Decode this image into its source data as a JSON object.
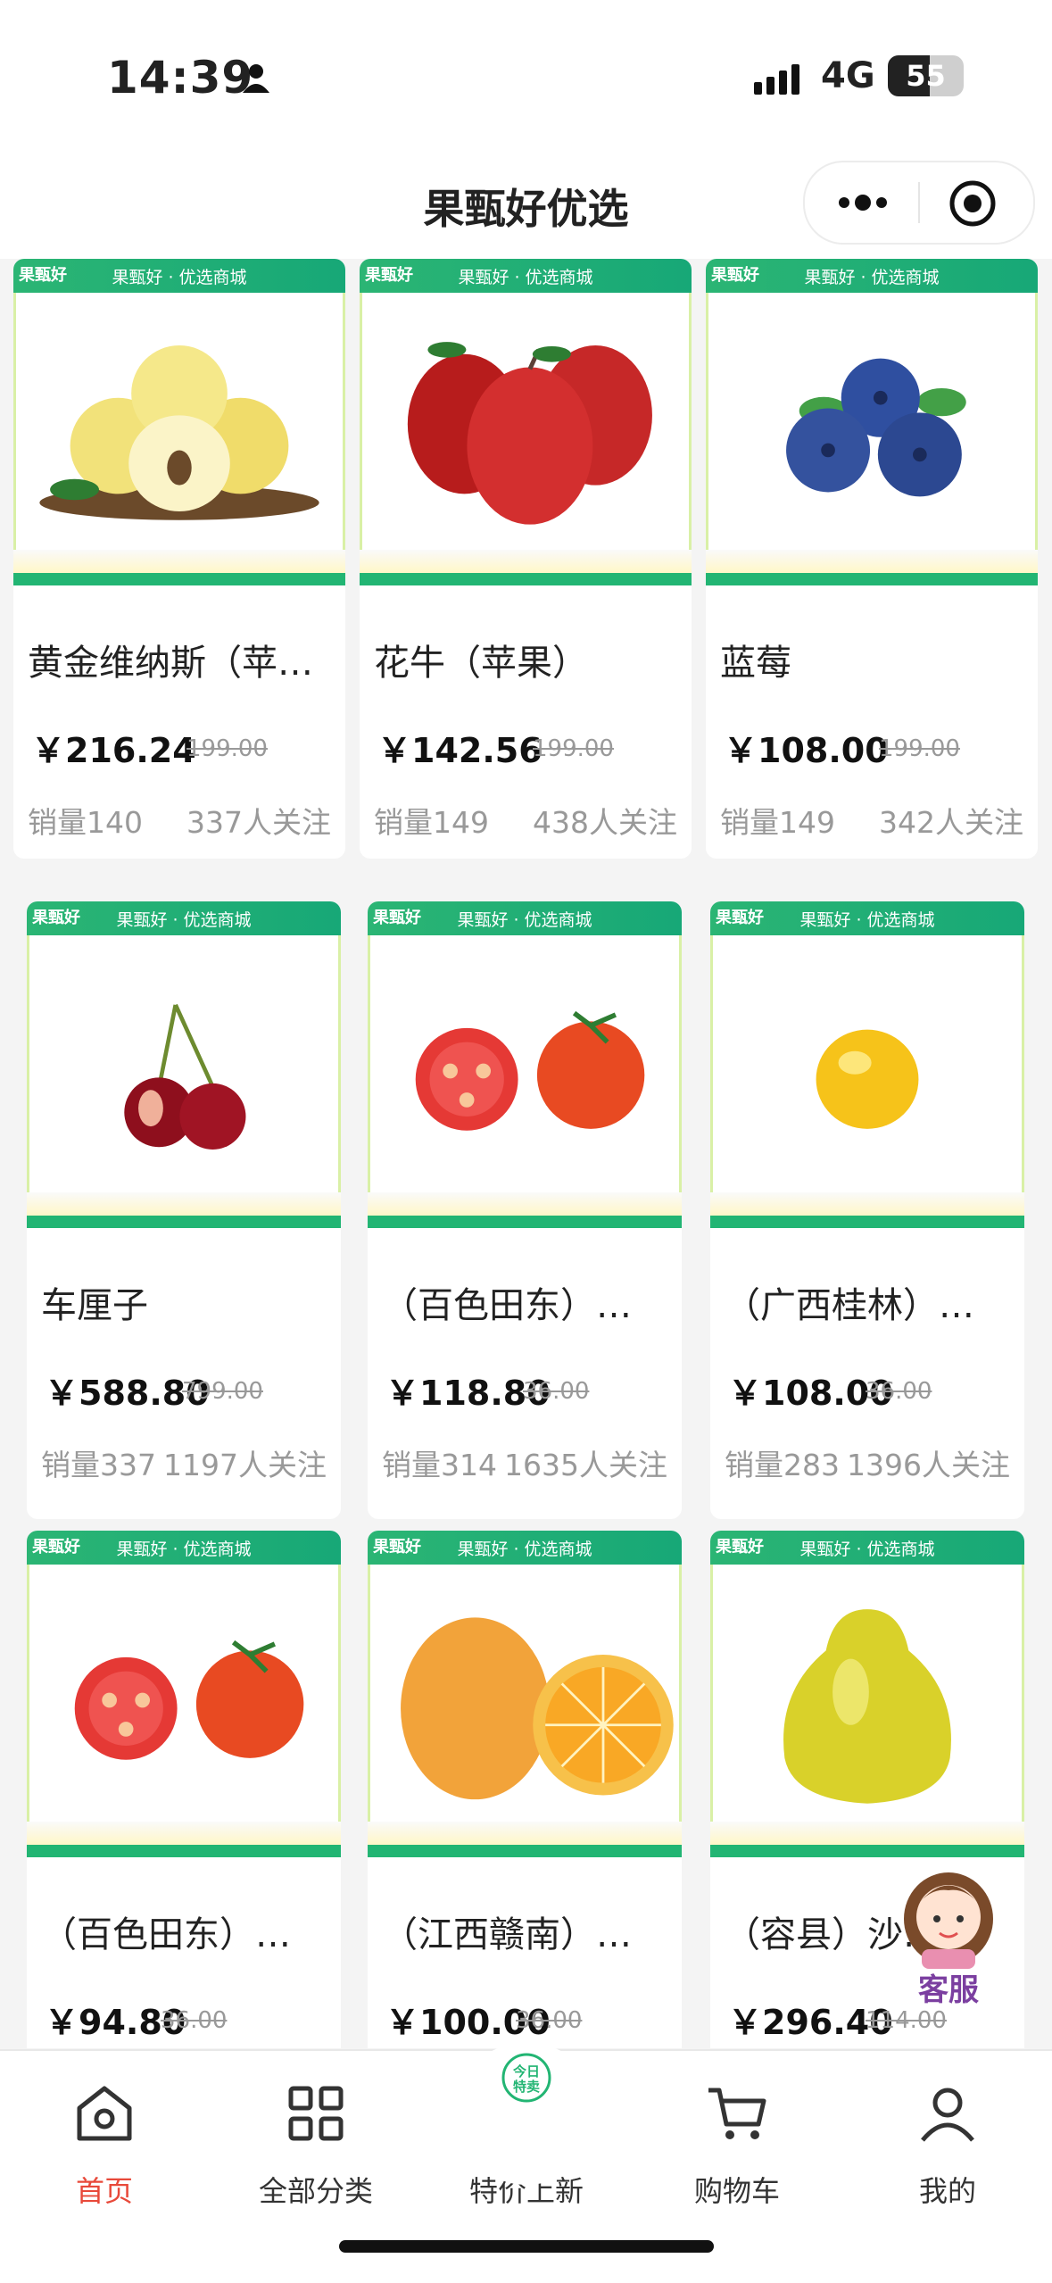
{
  "status_bar": {
    "time": "14:39",
    "network": "4G",
    "battery": "55",
    "battery_level": 0.55
  },
  "nav": {
    "title": "果甄好优选"
  },
  "banner": {
    "shop_text": "果甄好 · 优选商城",
    "logo_text": "果甄好"
  },
  "products": [
    {
      "name": "黄金维纳斯（苹果）",
      "price": "￥216.24",
      "old_price": "199.00",
      "sales": "销量140",
      "follow": "337人关注",
      "icon": "yellow-apple-icon"
    },
    {
      "name": "花牛（苹果）",
      "price": "￥142.56",
      "old_price": "199.00",
      "sales": "销量149",
      "follow": "438人关注",
      "icon": "red-apple-icon"
    },
    {
      "name": "蓝莓",
      "price": "￥108.00",
      "old_price": "199.00",
      "sales": "销量149",
      "follow": "342人关注",
      "icon": "blueberry-icon"
    },
    {
      "name": "车厘子",
      "price": "￥588.80",
      "old_price": "799.00",
      "sales": "销量337",
      "follow": "1197人关注",
      "icon": "cherry-icon"
    },
    {
      "name": "（百色田东）…",
      "price": "￥118.80",
      "old_price": "36.00",
      "sales": "销量314",
      "follow": "1635人关注",
      "icon": "tomato-icon"
    },
    {
      "name": "（广西桂林）…",
      "price": "￥108.00",
      "old_price": "36.00",
      "sales": "销量283",
      "follow": "1396人关注",
      "icon": "lemon-icon"
    },
    {
      "name": "（百色田东）…",
      "price": "￥94.80",
      "old_price": "36.00",
      "sales": "",
      "follow": "",
      "icon": "tomato-icon"
    },
    {
      "name": "（江西赣南）…",
      "price": "￥100.00",
      "old_price": "36.00",
      "sales": "",
      "follow": "",
      "icon": "orange-icon"
    },
    {
      "name": "（容县）沙…",
      "price": "￥296.40",
      "old_price": "114.00",
      "sales": "",
      "follow": "",
      "icon": "pomelo-icon"
    }
  ],
  "customer_service": {
    "label": "客服"
  },
  "special_badge": {
    "line1": "今日",
    "line2": "特卖"
  },
  "tabs": [
    {
      "label": "首页",
      "icon": "home-icon",
      "active": true
    },
    {
      "label": "全部分类",
      "icon": "grid-icon",
      "active": false
    },
    {
      "label": "特价上新",
      "icon": "special-sale-icon",
      "active": false
    },
    {
      "label": "购物车",
      "icon": "cart-icon",
      "active": false
    },
    {
      "label": "我的",
      "icon": "profile-icon",
      "active": false
    }
  ],
  "colors": {
    "brand_green": "#22b573",
    "active_tab": "#e8493a",
    "customer_service": "#7b3fa0"
  }
}
